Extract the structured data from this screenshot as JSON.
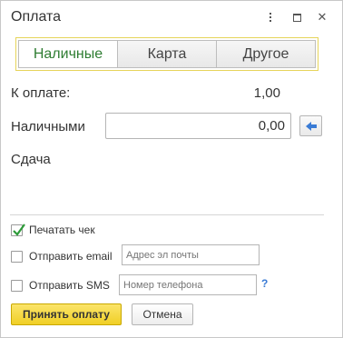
{
  "window": {
    "title": "Оплата",
    "controls": [
      "more-icon",
      "maximize-icon",
      "close-icon"
    ],
    "close_glyph": "✕"
  },
  "tabs": [
    {
      "label": "Наличные",
      "active": true
    },
    {
      "label": "Карта",
      "active": false
    },
    {
      "label": "Другое",
      "active": false
    }
  ],
  "payment": {
    "due_label": "К оплате:",
    "due_value": "1,00",
    "cash_label": "Наличными",
    "cash_value": "0,00",
    "change_label": "Сдача",
    "fill_icon": "arrow-left-icon"
  },
  "options": {
    "print_receipt": {
      "label": "Печатать чек",
      "checked": true
    },
    "send_email": {
      "label": "Отправить email",
      "checked": false,
      "placeholder": "Адрес эл почты"
    },
    "send_sms": {
      "label": "Отправить SMS",
      "checked": false,
      "placeholder": "Номер телефона"
    },
    "help_glyph": "?"
  },
  "buttons": {
    "accept_label": "Принять оплату",
    "cancel_label": "Отмена"
  },
  "colors": {
    "active_tab_text": "#2e7d32",
    "tab_frame_border": "#e6d45a",
    "primary_button": "#f0cf25",
    "fill_arrow": "#3a7bd5",
    "checkmark": "#2e9b3a",
    "help_link": "#3a7bd5"
  }
}
